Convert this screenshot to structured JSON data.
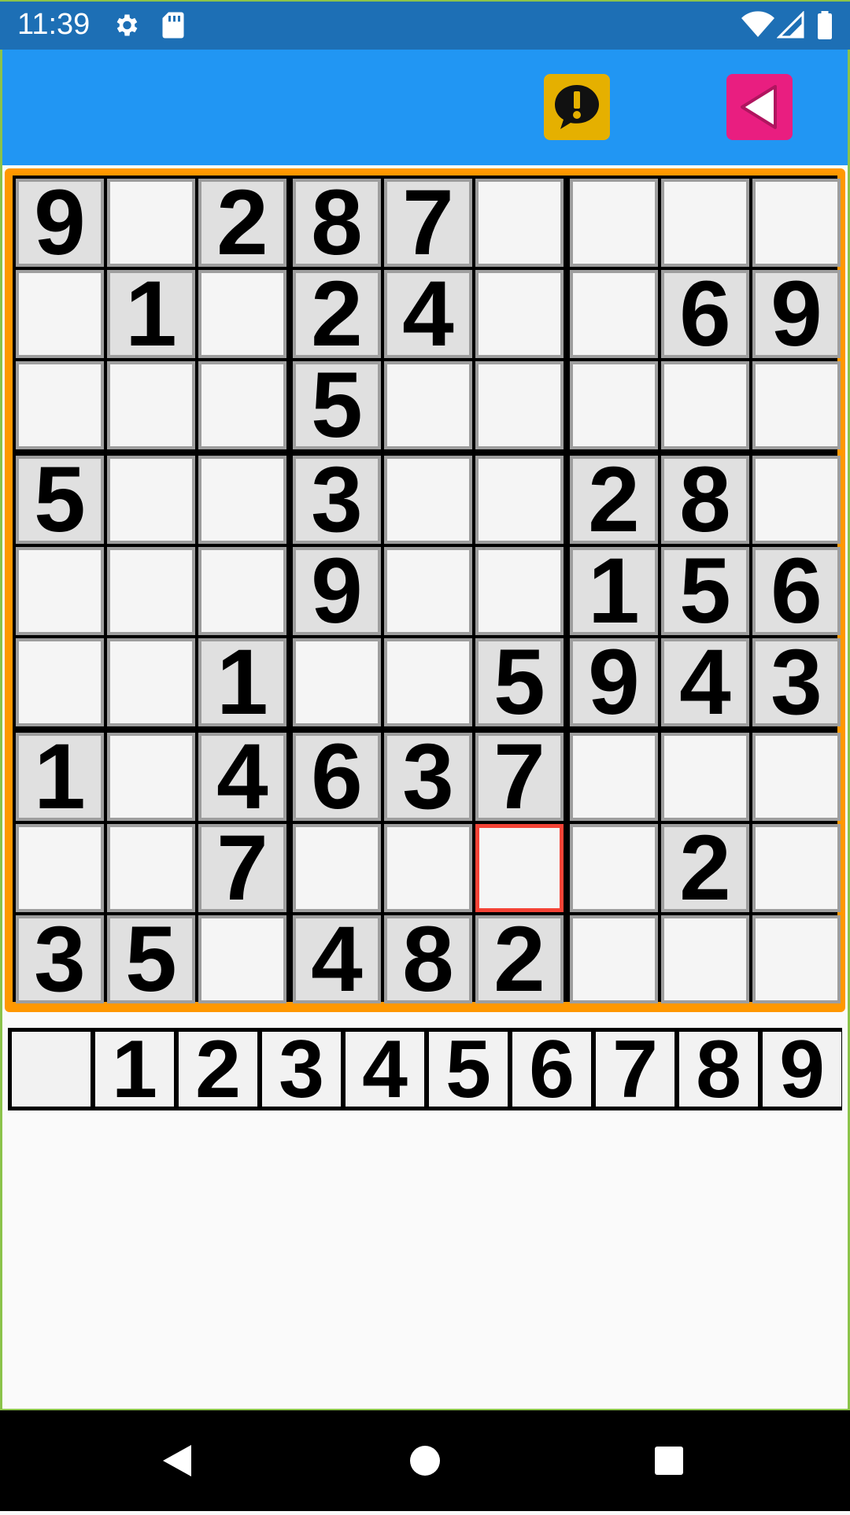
{
  "status_bar": {
    "time": "11:39",
    "icons": [
      "gear-icon",
      "sd-card-icon",
      "wifi-icon",
      "signal-icon",
      "battery-icon"
    ]
  },
  "app_bar": {
    "hint_icon": "alert-speech-bubble-icon",
    "back_icon": "back-triangle-icon",
    "colors": {
      "background": "#2196F3",
      "hint": "#E5B000",
      "back": "#E91E80"
    }
  },
  "board": {
    "rows": [
      [
        "9",
        "",
        "2",
        "8",
        "7",
        "",
        "",
        "",
        ""
      ],
      [
        "",
        "1",
        "",
        "2",
        "4",
        "",
        "",
        "6",
        "9"
      ],
      [
        "",
        "",
        "",
        "5",
        "",
        "",
        "",
        "",
        ""
      ],
      [
        "5",
        "",
        "",
        "3",
        "",
        "",
        "2",
        "8",
        ""
      ],
      [
        "",
        "",
        "",
        "9",
        "",
        "",
        "1",
        "5",
        "6"
      ],
      [
        "",
        "",
        "1",
        "",
        "",
        "5",
        "9",
        "4",
        "3"
      ],
      [
        "1",
        "",
        "4",
        "6",
        "3",
        "7",
        "",
        "",
        ""
      ],
      [
        "",
        "",
        "7",
        "",
        "",
        "",
        "",
        "2",
        ""
      ],
      [
        "3",
        "5",
        "",
        "4",
        "8",
        "2",
        "",
        "",
        ""
      ]
    ],
    "selected": {
      "row": 7,
      "col": 5
    },
    "colors": {
      "frame": "#FF9800",
      "given": "#E0E0E0",
      "empty": "#F5F5F5",
      "selected_border": "#F44336"
    }
  },
  "number_pad": {
    "keys": [
      "",
      "1",
      "2",
      "3",
      "4",
      "5",
      "6",
      "7",
      "8",
      "9"
    ]
  },
  "nav_bar": {
    "icons": [
      "back-nav-icon",
      "home-nav-icon",
      "recents-nav-icon"
    ]
  }
}
